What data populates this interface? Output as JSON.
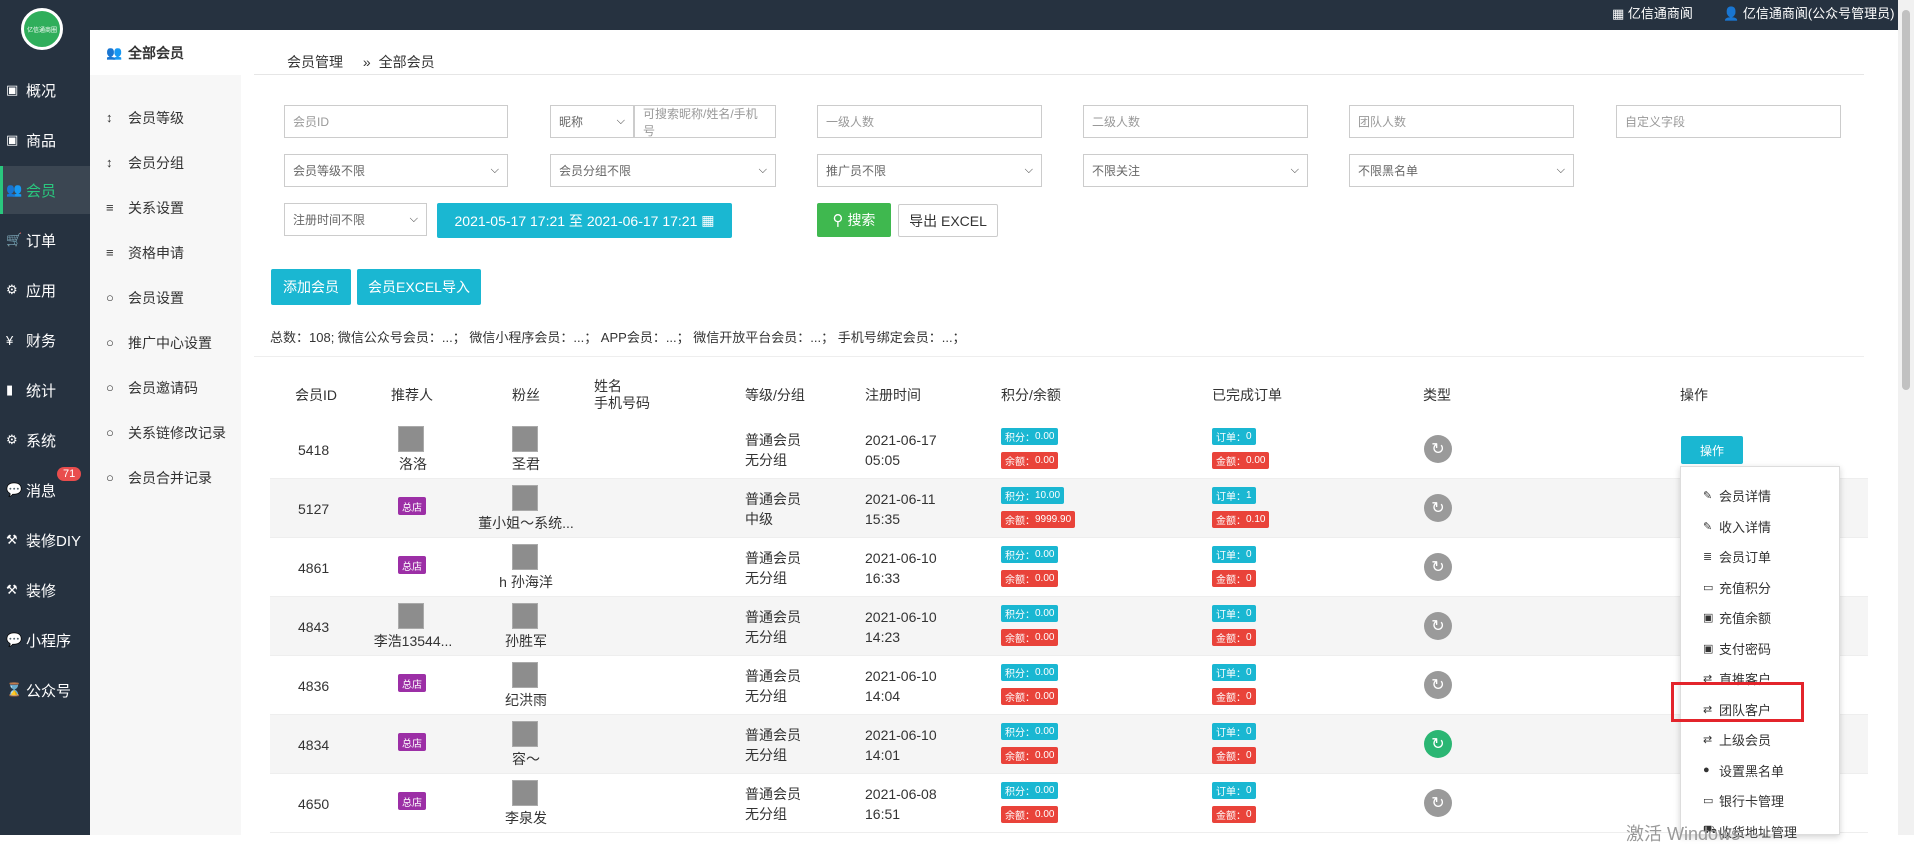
{
  "topbar": {
    "shop": "亿信通商阆",
    "user": "亿信通商阆(公众号管理员)",
    "logo_text": "亿信通商圈"
  },
  "nav1": [
    {
      "label": "概况",
      "icon": "▣"
    },
    {
      "label": "商品",
      "icon": "▣"
    },
    {
      "label": "会员",
      "icon": "👥"
    },
    {
      "label": "订单",
      "icon": "🛒"
    },
    {
      "label": "应用",
      "icon": "⚙"
    },
    {
      "label": "财务",
      "icon": "¥"
    },
    {
      "label": "统计",
      "icon": "▮"
    },
    {
      "label": "系统",
      "icon": "⚙"
    },
    {
      "label": "消息",
      "icon": "💬"
    },
    {
      "label": "装修DIY",
      "icon": "⚒"
    },
    {
      "label": "装修",
      "icon": "⚒"
    },
    {
      "label": "小程序",
      "icon": "💬"
    },
    {
      "label": "公众号",
      "icon": "⌛"
    }
  ],
  "badge": "71",
  "nav2": [
    {
      "label": "全部会员",
      "icon": "👥"
    },
    {
      "label": "会员等级",
      "icon": "↕"
    },
    {
      "label": "会员分组",
      "icon": "↕"
    },
    {
      "label": "关系设置",
      "icon": "≡"
    },
    {
      "label": "资格申请",
      "icon": "≡"
    },
    {
      "label": "会员设置",
      "icon": "○"
    },
    {
      "label": "推广中心设置",
      "icon": "○"
    },
    {
      "label": "会员邀请码",
      "icon": "○"
    },
    {
      "label": "关系链修改记录",
      "icon": "○"
    },
    {
      "label": "会员合并记录",
      "icon": "○"
    }
  ],
  "crumb": {
    "first": "会员管理",
    "second": "全部会员",
    "sep": "»"
  },
  "filters": {
    "member_id": "会员ID",
    "nick_select": "昵称",
    "nick_ph": "可搜索昵称/姓名/手机号",
    "level1": "一级人数",
    "level2": "二级人数",
    "team": "团队人数",
    "custom": "自定义字段",
    "level_select": "会员等级不限",
    "group_select": "会员分组不限",
    "promoter_select": "推广员不限",
    "follow_select": "不限关注",
    "black_select": "不限黑名单",
    "reg_select": "注册时间不限",
    "date_range": "2021-05-17 17:21 至 2021-06-17 17:21",
    "search": "搜索",
    "export": "导出 EXCEL"
  },
  "actions": {
    "add": "添加会员",
    "import": "会员EXCEL导入"
  },
  "summary": "总数：108; 微信公众号会员：...； 微信小程序会员：...； APP会员：...； 微信开放平台会员：...； 手机号绑定会员：...；",
  "headers": {
    "id": "会员ID",
    "ref": "推荐人",
    "fans": "粉丝",
    "name1": "姓名",
    "name2": "手机号码",
    "level": "等级/分组",
    "reg": "注册时间",
    "points": "积分/余额",
    "orders": "已完成订单",
    "type": "类型",
    "op": "操作"
  },
  "labels": {
    "shop": "总店",
    "points": "积分：",
    "balance": "余额：",
    "order": "订单：",
    "amount": "金额："
  },
  "rows": [
    {
      "id": "5418",
      "ref": "洛洛",
      "fans": "圣君",
      "level": "普通会员",
      "group": "无分组",
      "date": "2021-06-17",
      "time": "05:05",
      "points": "0.00",
      "balance": "0.00",
      "orders": "0",
      "amount": "0.00"
    },
    {
      "id": "5127",
      "ref": "",
      "fans": "董小姐～系统...",
      "level": "普通会员",
      "group": "中级",
      "date": "2021-06-11",
      "time": "15:35",
      "points": "10.00",
      "balance": "9999.90",
      "orders": "1",
      "amount": "0.10"
    },
    {
      "id": "4861",
      "ref": "",
      "fans": "h 孙海洋",
      "level": "普通会员",
      "group": "无分组",
      "date": "2021-06-10",
      "time": "16:33",
      "points": "0.00",
      "balance": "0.00",
      "orders": "0",
      "amount": "0"
    },
    {
      "id": "4843",
      "ref": "李浩13544...",
      "fans": "孙胜军",
      "level": "普通会员",
      "group": "无分组",
      "date": "2021-06-10",
      "time": "14:23",
      "points": "0.00",
      "balance": "0.00",
      "orders": "0",
      "amount": "0"
    },
    {
      "id": "4836",
      "ref": "",
      "fans": "纪洪雨",
      "level": "普通会员",
      "group": "无分组",
      "date": "2021-06-10",
      "time": "14:04",
      "points": "0.00",
      "balance": "0.00",
      "orders": "0",
      "amount": "0"
    },
    {
      "id": "4834",
      "ref": "",
      "fans": "容～",
      "level": "普通会员",
      "group": "无分组",
      "date": "2021-06-10",
      "time": "14:01",
      "points": "0.00",
      "balance": "0.00",
      "orders": "0",
      "amount": "0"
    },
    {
      "id": "4650",
      "ref": "",
      "fans": "李泉发",
      "level": "普通会员",
      "group": "无分组",
      "date": "2021-06-08",
      "time": "16:51",
      "points": "0.00",
      "balance": "0.00",
      "orders": "0",
      "amount": "0"
    }
  ],
  "op_button": "操作",
  "menu": [
    {
      "label": "会员详情",
      "icon": "✎"
    },
    {
      "label": "收入详情",
      "icon": "✎"
    },
    {
      "label": "会员订单",
      "icon": "≣"
    },
    {
      "label": "充值积分",
      "icon": "▭"
    },
    {
      "label": "充值余额",
      "icon": "▣"
    },
    {
      "label": "支付密码",
      "icon": "▣"
    },
    {
      "label": "直推客户",
      "icon": "⇄"
    },
    {
      "label": "团队客户",
      "icon": "⇄"
    },
    {
      "label": "上级会员",
      "icon": "⇄"
    },
    {
      "label": "设置黑名单",
      "icon": "●"
    },
    {
      "label": "银行卡管理",
      "icon": "▭"
    },
    {
      "label": "收货地址管理",
      "icon": "⛟"
    }
  ],
  "watermark": "激活 Windows",
  "colors": {
    "accent": "#1ab7d2",
    "search": "#3fb84f",
    "nav_bg": "#263240",
    "active": "#2ac77e"
  }
}
